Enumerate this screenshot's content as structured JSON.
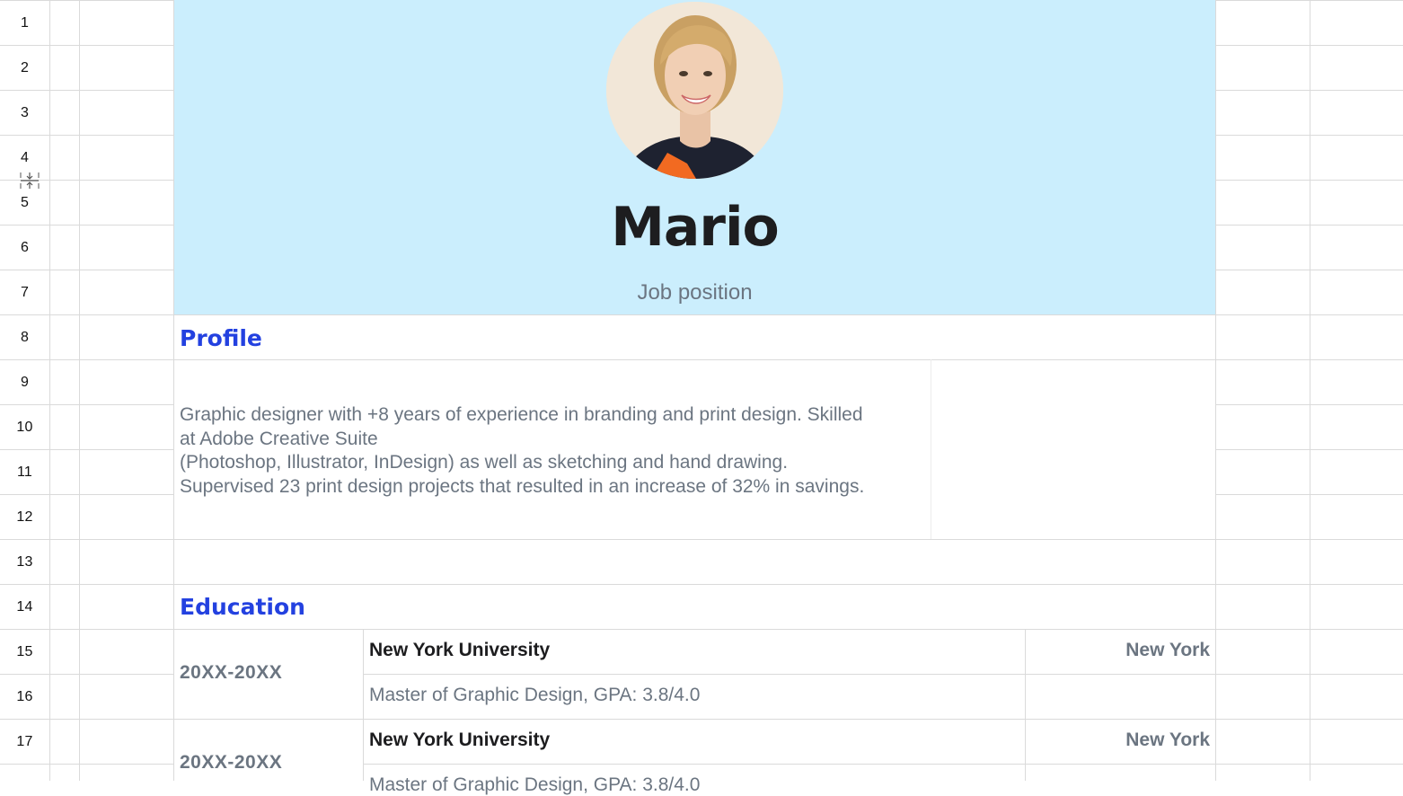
{
  "row_numbers": [
    "1",
    "2",
    "3",
    "4",
    "5",
    "6",
    "7",
    "8",
    "9",
    "10",
    "11",
    "12",
    "13",
    "14",
    "15",
    "16",
    "17"
  ],
  "header": {
    "name": "Mario",
    "job_position": "Job position",
    "band_color": "#cbeefd"
  },
  "profile": {
    "title": "Profile",
    "lines": [
      "Graphic designer with +8 years of experience in branding and print design. Skilled",
      "at Adobe Creative Suite",
      "(Photoshop, Illustrator, InDesign) as well as sketching and hand drawing.",
      "Supervised 23 print design projects that resulted in an increase of 32% in savings."
    ]
  },
  "education": {
    "title": "Education",
    "entries": [
      {
        "years": "20XX-20XX",
        "school": "New York University",
        "city": "New York",
        "degree": "Master of Graphic Design, GPA: 3.8/4.0"
      },
      {
        "years": "20XX-20XX",
        "school": "New York University",
        "city": "New York",
        "degree": "Master of Graphic Design, GPA: 3.8/4.0"
      }
    ]
  },
  "colors": {
    "accent": "#2341e0",
    "muted_text": "#6b7581",
    "dark_text": "#1d1d1f",
    "grid": "#dadada"
  },
  "icons": {
    "row_resize": "row-resize-icon",
    "avatar": "profile-photo"
  }
}
